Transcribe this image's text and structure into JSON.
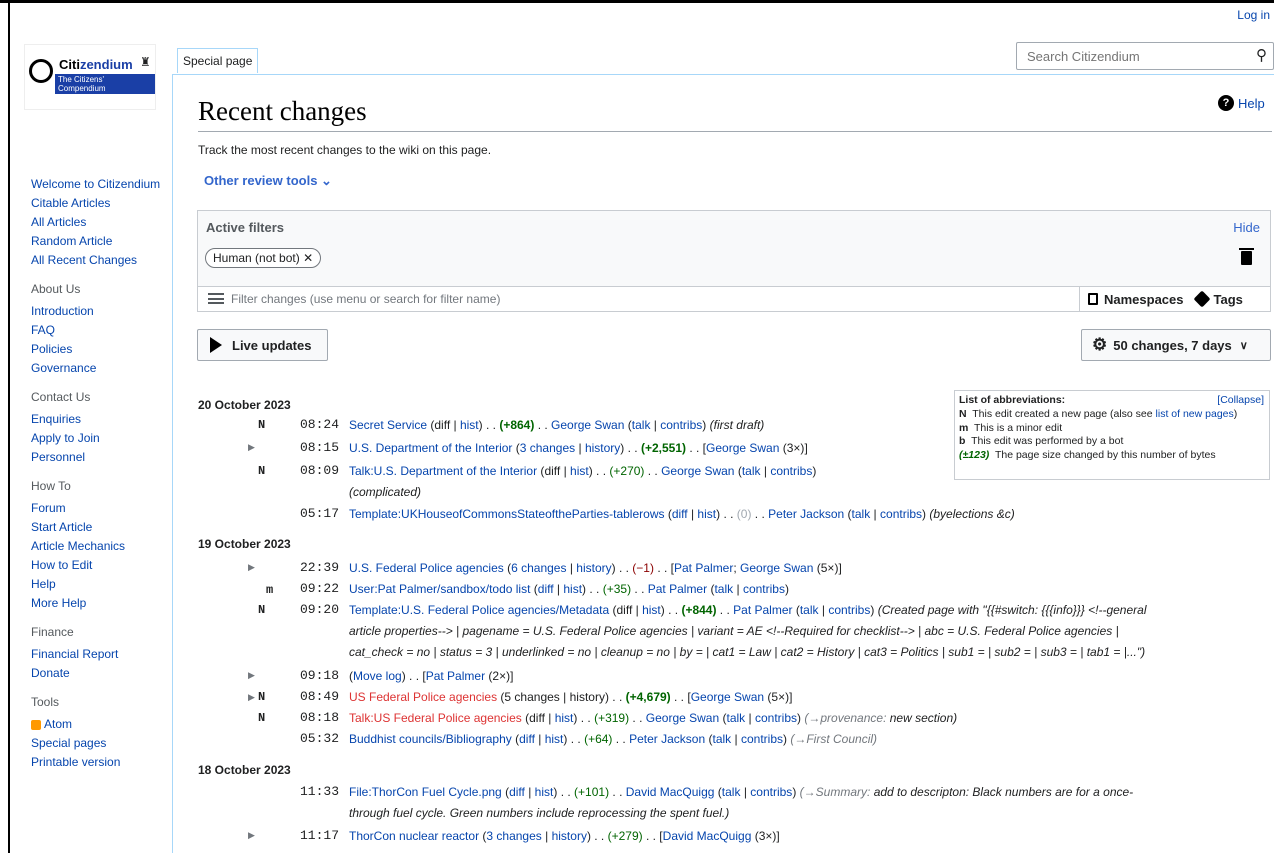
{
  "header": {
    "login": "Log in",
    "tab": "Special page",
    "search_placeholder": "Search Citizendium"
  },
  "logo": {
    "name_a": "Citi",
    "name_b": "zendium",
    "tagline": "The Citizens' Compendium"
  },
  "sidebar": {
    "main": [
      "Welcome to Citizendium",
      "Citable Articles",
      "All Articles",
      "Random Article",
      "All Recent Changes"
    ],
    "about": {
      "heading": "About Us",
      "items": [
        "Introduction",
        "FAQ",
        "Policies",
        "Governance"
      ]
    },
    "contact": {
      "heading": "Contact Us",
      "items": [
        "Enquiries",
        "Apply to Join",
        "Personnel"
      ]
    },
    "howto": {
      "heading": "How To",
      "items": [
        "Forum",
        "Start Article",
        "Article Mechanics",
        "How to Edit",
        "Help",
        "More Help"
      ]
    },
    "finance": {
      "heading": "Finance",
      "items": [
        "Financial Report",
        "Donate"
      ]
    },
    "tools": {
      "heading": "Tools",
      "items": [
        "Atom",
        "Special pages",
        "Printable version"
      ]
    }
  },
  "page": {
    "title": "Recent changes",
    "help": "Help",
    "description": "Track the most recent changes to the wiki on this page.",
    "review_tools": "Other review tools"
  },
  "filters": {
    "label": "Active filters",
    "hide": "Hide",
    "chip": "Human (not bot)",
    "placeholder": "Filter changes (use menu or search for filter name)",
    "namespaces": "Namespaces",
    "tags": "Tags"
  },
  "controls": {
    "live": "Live updates",
    "changes": "50 changes, 7 days"
  },
  "abbr": {
    "title": "List of abbreviations:",
    "collapse": "[Collapse]",
    "n": "This edit created a new page (also see ",
    "n_link": "list of new pages",
    "n_end": ")",
    "m": "This is a minor edit",
    "b": "This edit was performed by a bot",
    "size": "(±123)",
    "size_text": "The page size changed by this number of bytes"
  },
  "days": [
    "20 October 2023",
    "19 October 2023",
    "18 October 2023"
  ],
  "changes": {
    "c1": {
      "time": "08:24",
      "flag": "N",
      "page": "Secret Service",
      "diff": "+864",
      "user": "George Swan",
      "comment": "(first draft)"
    },
    "c2": {
      "time": "08:15",
      "page": "U.S. Department of the Interior",
      "count": "3 changes",
      "diff": "+2,551",
      "user": "George Swan",
      "times": "(3×)"
    },
    "c3": {
      "time": "08:09",
      "flag": "N",
      "page": "Talk:U.S. Department of the Interior",
      "diff": "+270",
      "user": "George Swan",
      "comment": "(complicated)"
    },
    "c4": {
      "time": "05:17",
      "page": "Template:UKHouseofCommonsStateoftheParties-tablerows",
      "diff": "0",
      "user": "Peter Jackson",
      "comment": "(byelections &c)"
    },
    "c5": {
      "time": "22:39",
      "page": "U.S. Federal Police agencies",
      "count": "6 changes",
      "diff": "−1",
      "user1": "Pat Palmer",
      "user2": "George Swan",
      "times": "(5×)"
    },
    "c6": {
      "time": "09:22",
      "flag": "m",
      "page": "User:Pat Palmer/sandbox/todo list",
      "diff": "+35",
      "user": "Pat Palmer"
    },
    "c7": {
      "time": "09:20",
      "flag": "N",
      "page": "Template:U.S. Federal Police agencies/Metadata",
      "diff": "+844",
      "user": "Pat Palmer",
      "comment1": "(Created page with \"{{#switch: {{{info}}} <!--general",
      "comment2": "article properties--> | pagename = U.S. Federal Police agencies | variant = AE <!--Required for checklist--> | abc = U.S. Federal Police agencies |",
      "comment3": "cat_check = no | status = 3 | underlinked = no | cleanup = no | by = | cat1 = Law | cat2 = History | cat3 = Politics | sub1 = | sub2 = | sub3 = | tab1 = |...\")"
    },
    "c8": {
      "time": "09:18",
      "page": "Move log",
      "user": "Pat Palmer",
      "times": "(2×)"
    },
    "c9": {
      "time": "08:49",
      "flag": "N",
      "page": "US Federal Police agencies",
      "count": "5 changes",
      "diff": "+4,679",
      "user": "George Swan",
      "times": "(5×)"
    },
    "c10": {
      "time": "08:18",
      "flag": "N",
      "page": "Talk:US Federal Police agencies",
      "diff": "+319",
      "user": "George Swan",
      "section": "→provenance:",
      "comment": "new section)"
    },
    "c11": {
      "time": "05:32",
      "page": "Buddhist councils/Bibliography",
      "diff": "+64",
      "user": "Peter Jackson",
      "section": "→First Council"
    },
    "c12": {
      "time": "11:33",
      "page": "File:ThorCon Fuel Cycle.png",
      "diff": "+101",
      "user": "David MacQuigg",
      "section": "→Summary:",
      "comment1": "add to descripton: Black numbers are for a once-",
      "comment2": "through fuel cycle. Green numbers include reprocessing the spent fuel.)"
    },
    "c13": {
      "time": "11:17",
      "page": "ThorCon nuclear reactor",
      "count": "3 changes",
      "diff": "+279",
      "user": "David MacQuigg",
      "times": "(3×)"
    }
  },
  "labels": {
    "diff": "diff",
    "hist": "hist",
    "history": "history",
    "talk": "talk",
    "contribs": "contribs"
  }
}
